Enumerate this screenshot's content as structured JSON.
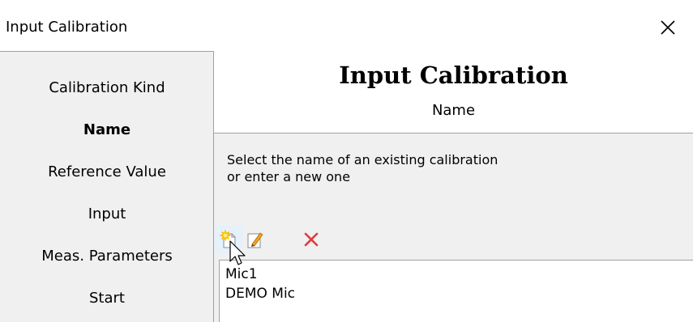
{
  "window": {
    "title": "Input Calibration"
  },
  "sidebar": {
    "steps": [
      {
        "label": "Calibration Kind",
        "active": false
      },
      {
        "label": "Name",
        "active": true
      },
      {
        "label": "Reference Value",
        "active": false
      },
      {
        "label": "Input",
        "active": false
      },
      {
        "label": "Meas. Parameters",
        "active": false
      },
      {
        "label": "Start",
        "active": false
      }
    ]
  },
  "header": {
    "title": "Input Calibration",
    "subtitle": "Name"
  },
  "content": {
    "instruction_line1": "Select the name of an existing calibration",
    "instruction_line2": "or enter a new one",
    "toolbar": [
      {
        "icon": "new-star-icon",
        "tooltip": ""
      },
      {
        "icon": "edit-pencil-icon",
        "tooltip": ""
      },
      {
        "icon": "delete-x-icon",
        "tooltip": ""
      }
    ],
    "list": [
      "Mic1",
      "DEMO Mic"
    ]
  },
  "colors": {
    "delete": "#e03c3c",
    "hover": "#e5f1fb",
    "panel": "#f0f0f0"
  }
}
